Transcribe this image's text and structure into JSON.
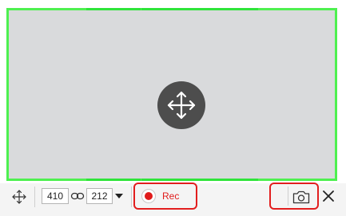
{
  "capture": {
    "frame_color": "#4ef050",
    "move_icon": "move-arrows-icon"
  },
  "toolbar": {
    "move_icon": "move-arrows-icon",
    "width_value": "410",
    "height_value": "212",
    "link_icon": "link-icon",
    "size_dropdown_icon": "chevron-down-icon",
    "rec_label": "Rec",
    "rec_color": "#e01b1b",
    "screenshot_icon": "camera-icon",
    "close_icon": "close-icon"
  }
}
